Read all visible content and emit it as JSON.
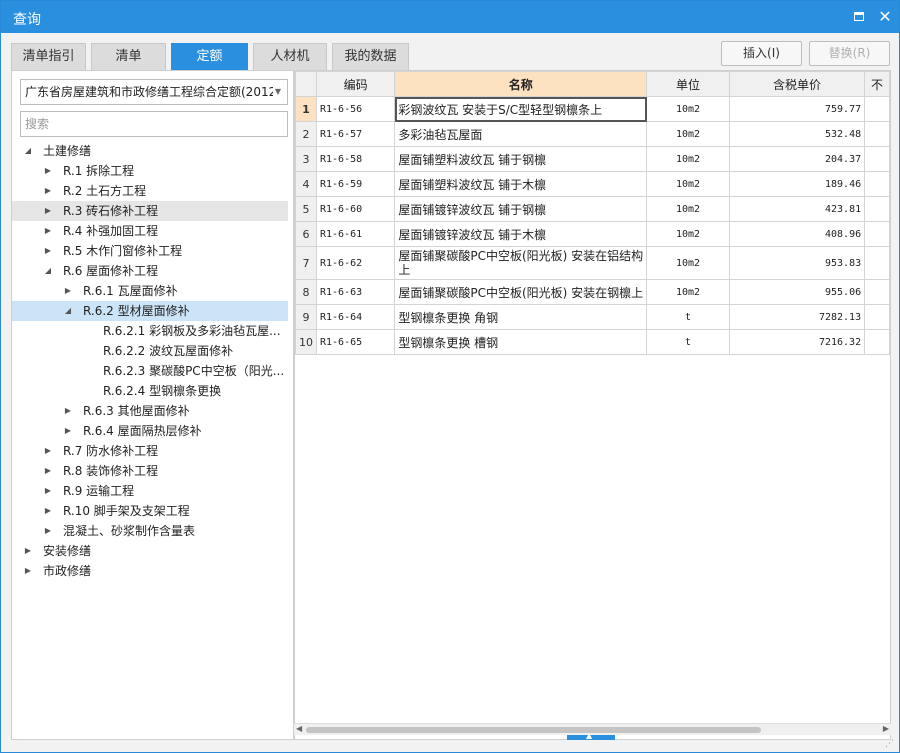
{
  "window": {
    "title": "查询"
  },
  "tabs": [
    "清单指引",
    "清单",
    "定额",
    "人材机",
    "我的数据"
  ],
  "active_tab": "定额",
  "toolbar": {
    "insert_label": "插入(I)",
    "replace_label": "替换(R)"
  },
  "left": {
    "library": "广东省房屋建筑和市政修缮工程综合定额(2012)",
    "search_placeholder": "搜索",
    "tree": [
      {
        "label": "土建修缮",
        "caret": "open"
      },
      {
        "label": "R.1 拆除工程",
        "caret": "closed"
      },
      {
        "label": "R.2 土石方工程",
        "caret": "closed"
      },
      {
        "label": "R.3 砖石修补工程",
        "caret": "closed"
      },
      {
        "label": "R.4 补强加固工程",
        "caret": "closed"
      },
      {
        "label": "R.5 木作门窗修补工程",
        "caret": "closed"
      },
      {
        "label": "R.6 屋面修补工程",
        "caret": "open"
      },
      {
        "label": "R.6.1 瓦屋面修补",
        "caret": "closed"
      },
      {
        "label": "R.6.2 型材屋面修补",
        "caret": "open"
      },
      {
        "label": "R.6.2.1 彩钢板及多彩油毡瓦屋...",
        "caret": ""
      },
      {
        "label": "R.6.2.2 波纹瓦屋面修补",
        "caret": ""
      },
      {
        "label": "R.6.2.3 聚碳酸PC中空板（阳光...",
        "caret": ""
      },
      {
        "label": "R.6.2.4 型钢檩条更换",
        "caret": ""
      },
      {
        "label": "R.6.3 其他屋面修补",
        "caret": "closed"
      },
      {
        "label": "R.6.4 屋面隔热层修补",
        "caret": "closed"
      },
      {
        "label": "R.7 防水修补工程",
        "caret": "closed"
      },
      {
        "label": "R.8 装饰修补工程",
        "caret": "closed"
      },
      {
        "label": "R.9 运输工程",
        "caret": "closed"
      },
      {
        "label": "R.10 脚手架及支架工程",
        "caret": "closed"
      },
      {
        "label": "混凝土、砂浆制作含量表",
        "caret": "closed"
      },
      {
        "label": "安装修缮",
        "caret": "closed"
      },
      {
        "label": "市政修缮",
        "caret": "closed"
      }
    ]
  },
  "grid": {
    "headers": [
      "编码",
      "名称",
      "单位",
      "含税单价",
      "不"
    ],
    "rows": [
      {
        "no": "1",
        "code": "R1-6-56",
        "name": "彩钢波纹瓦 安装于S/C型轻型钢檩条上",
        "unit": "10m2",
        "price": "759.77"
      },
      {
        "no": "2",
        "code": "R1-6-57",
        "name": "多彩油毡瓦屋面",
        "unit": "10m2",
        "price": "532.48"
      },
      {
        "no": "3",
        "code": "R1-6-58",
        "name": "屋面铺塑料波纹瓦 铺于钢檩",
        "unit": "10m2",
        "price": "204.37"
      },
      {
        "no": "4",
        "code": "R1-6-59",
        "name": "屋面铺塑料波纹瓦 铺于木檩",
        "unit": "10m2",
        "price": "189.46"
      },
      {
        "no": "5",
        "code": "R1-6-60",
        "name": "屋面铺镀锌波纹瓦 铺于钢檩",
        "unit": "10m2",
        "price": "423.81"
      },
      {
        "no": "6",
        "code": "R1-6-61",
        "name": "屋面铺镀锌波纹瓦 铺于木檩",
        "unit": "10m2",
        "price": "408.96"
      },
      {
        "no": "7",
        "code": "R1-6-62",
        "name": "屋面铺聚碳酸PC中空板(阳光板) 安装在铝结构上",
        "unit": "10m2",
        "price": "953.83"
      },
      {
        "no": "8",
        "code": "R1-6-63",
        "name": "屋面铺聚碳酸PC中空板(阳光板) 安装在钢檩上",
        "unit": "10m2",
        "price": "955.06"
      },
      {
        "no": "9",
        "code": "R1-6-64",
        "name": "型钢檩条更换 角钢",
        "unit": "t",
        "price": "7282.13"
      },
      {
        "no": "10",
        "code": "R1-6-65",
        "name": "型钢檩条更换 槽钢",
        "unit": "t",
        "price": "7216.32"
      }
    ]
  },
  "colors": {
    "accent": "#2b8fe0",
    "selected_header": "#fde2c2",
    "tree_selected": "#cce4f7"
  }
}
